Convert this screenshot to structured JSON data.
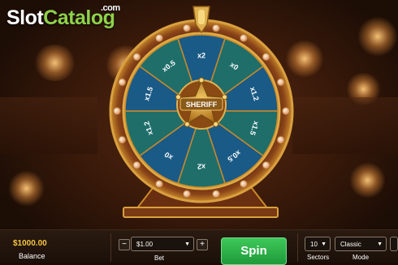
{
  "logo": {
    "slot": "Slot",
    "catalog": "Catalog",
    "com": ".com"
  },
  "wheel": {
    "hub_label": "SHERIFF",
    "sectors": [
      "x2",
      "x0",
      "x1.2",
      "x1.5",
      "x0.5",
      "x2",
      "x0",
      "x1.2",
      "x1.5",
      "x0.5"
    ],
    "colors": {
      "teal": "#1f6e6a",
      "blue": "#1a5a86",
      "gold": "#c98a2a",
      "rim": "#7a3a14"
    }
  },
  "balance": {
    "amount": "$1000.00",
    "label": "Balance"
  },
  "bet": {
    "minus": "−",
    "value": "$1.00",
    "plus": "+",
    "label": "Bet"
  },
  "spin": {
    "label": "Spin"
  },
  "sectors": {
    "value": "10",
    "label": "Sectors"
  },
  "mode": {
    "value": "Classic",
    "label": "Mode"
  }
}
